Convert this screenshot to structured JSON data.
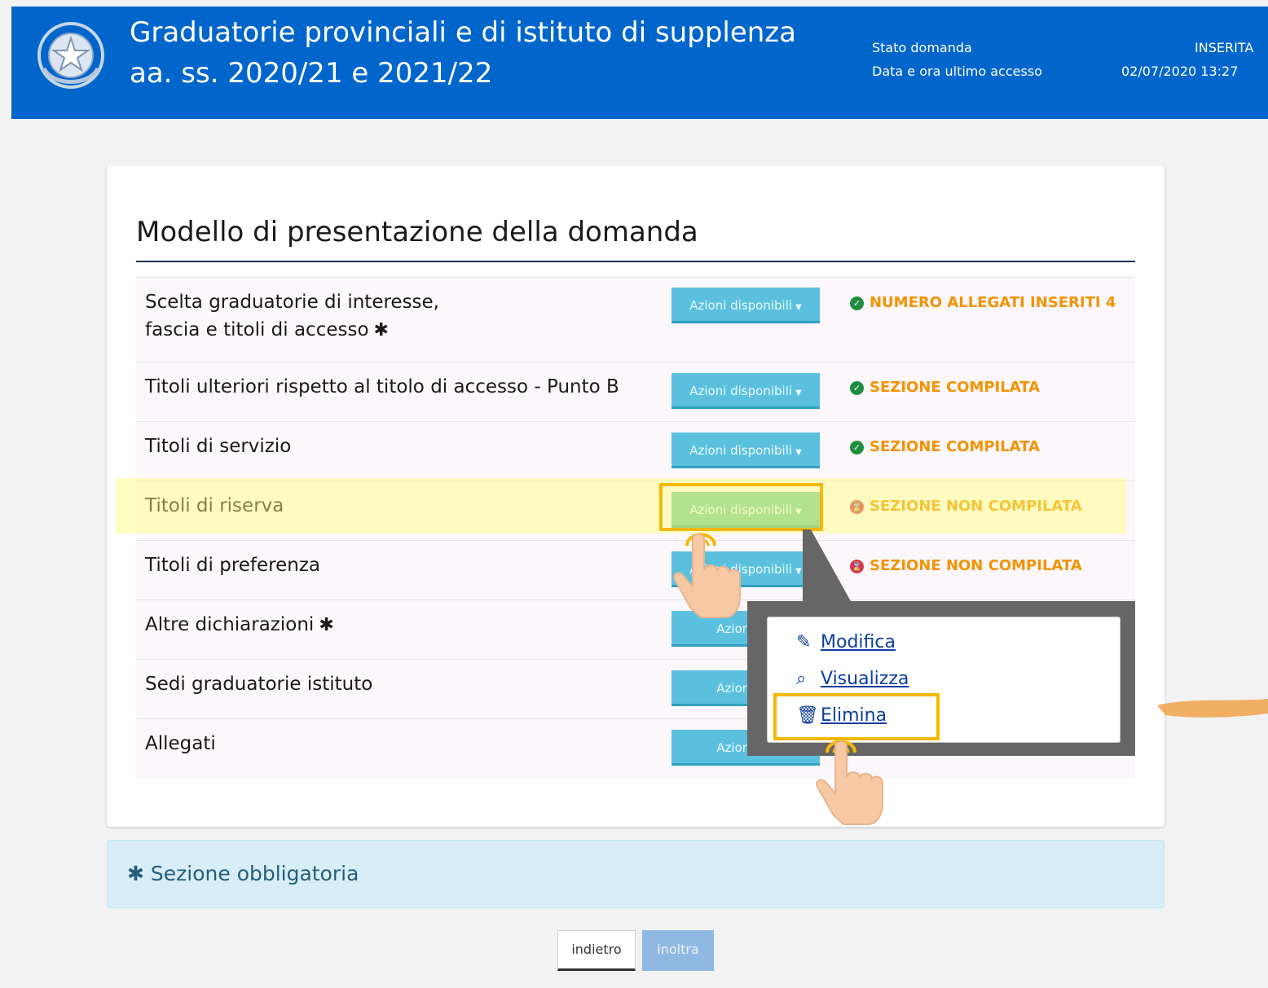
{
  "header": {
    "title_line1": "Graduatorie provinciali e di istituto di supplenza",
    "title_line2": "aa. ss. 2020/21 e 2021/22",
    "stato_label": "Stato domanda",
    "stato_value": "INSERITA",
    "accesso_label": "Data e ora ultimo accesso",
    "accesso_value": "02/07/2020 13:27"
  },
  "main": {
    "title": "Modello di presentazione della domanda",
    "action_label": "Azioni disponibili",
    "truncated_action_label": "Azioni dis",
    "sections": [
      {
        "label_line1": "Scelta graduatorie di interesse,",
        "label_line2": "fascia e titoli di accesso",
        "mandatory": true,
        "status": "NUMERO ALLEGATI INSERITI 4",
        "status_icon": "check-icon"
      },
      {
        "label": "Titoli ulteriori rispetto al titolo di accesso - Punto B",
        "status": "SEZIONE COMPILATA",
        "status_icon": "check-icon"
      },
      {
        "label": "Titoli di servizio",
        "status": "SEZIONE COMPILATA",
        "status_icon": "check-icon"
      },
      {
        "label": "Titoli di riserva",
        "status": "SEZIONE NON COMPILATA",
        "status_icon": "hourglass-icon"
      },
      {
        "label": "Titoli di preferenza",
        "status": "SEZIONE NON COMPILATA",
        "status_icon": "hourglass-icon"
      },
      {
        "label": "Altre dichiarazioni",
        "mandatory": true
      },
      {
        "label": "Sedi graduatorie istituto"
      },
      {
        "label": "Allegati"
      }
    ]
  },
  "dropdown": {
    "modifica": "Modifica",
    "visualizza": "Visualizza",
    "elimina": "Elimina"
  },
  "notice": {
    "text": "Sezione obbligatoria"
  },
  "footer": {
    "back_label": "indietro",
    "next_label": "inoltra"
  },
  "colors": {
    "header_bg": "#0066cc",
    "button_bg": "#5bc0de",
    "status_text": "#f39200",
    "ok_icon": "#1e8e3e",
    "warning_icon": "#d9364f",
    "highlight": "#f5b800"
  }
}
